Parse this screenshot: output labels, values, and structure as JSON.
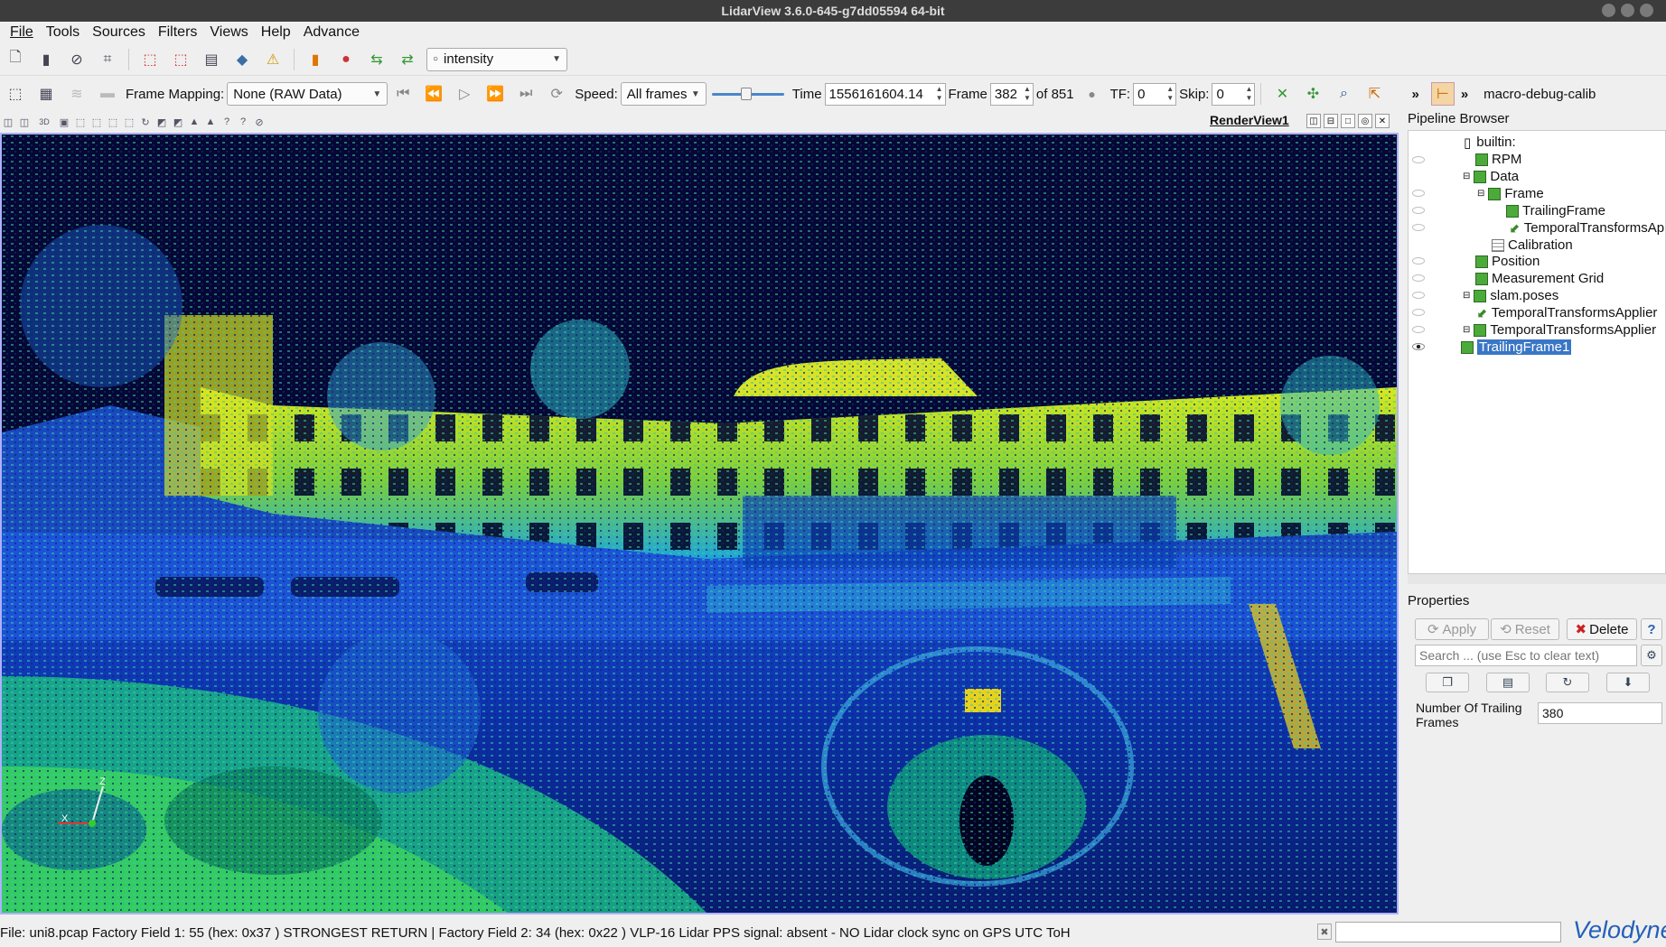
{
  "window": {
    "title": "LidarView 3.6.0-645-g7dd05594 64-bit"
  },
  "menu": [
    "File",
    "Tools",
    "Sources",
    "Filters",
    "Views",
    "Help",
    "Advance"
  ],
  "toolbar1": {
    "color_by": "intensity"
  },
  "toolbar2": {
    "frame_mapping_label": "Frame Mapping:",
    "frame_mapping_value": "None (RAW Data)",
    "speed_label": "Speed:",
    "speed_value": "All frames",
    "time_label": "Time",
    "time_value": "1556161604.14",
    "frame_label": "Frame",
    "frame_value": "382",
    "of_label": "of 851",
    "tf_label": "TF:",
    "tf_value": "0",
    "skip_label": "Skip:",
    "skip_value": "0",
    "overflow": "»",
    "overflow2": "»",
    "macro_label": "macro-debug-calib"
  },
  "render_view": {
    "title": "RenderView1",
    "axes": {
      "z": "Z",
      "x": "X"
    }
  },
  "pipeline_browser": {
    "title": "Pipeline Browser",
    "items": [
      {
        "label": "builtin:"
      },
      {
        "label": "RPM"
      },
      {
        "label": "Data"
      },
      {
        "label": "Frame"
      },
      {
        "label": "TrailingFrame"
      },
      {
        "label": "TemporalTransformsAp"
      },
      {
        "label": "Calibration"
      },
      {
        "label": "Position"
      },
      {
        "label": "Measurement Grid"
      },
      {
        "label": "slam.poses"
      },
      {
        "label": "TemporalTransformsApplier"
      },
      {
        "label": "TemporalTransformsApplier"
      },
      {
        "label": "TrailingFrame1"
      }
    ]
  },
  "properties": {
    "title": "Properties",
    "apply_label": "Apply",
    "reset_label": "Reset",
    "delete_label": "Delete",
    "help_label": "?",
    "search_placeholder": "Search ... (use Esc to clear text)",
    "trailing_label": "Number Of Trailing Frames",
    "trailing_value": "380"
  },
  "status_bar": {
    "text": "File: uni8.pcap     Factory Field 1: 55 (hex: 0x37 ) STRONGEST RETURN  |  Factory Field 2: 34 (hex: 0x22 ) VLP-16   Lidar PPS signal: absent - NO Lidar clock sync on GPS UTC ToH",
    "logo": "Velodyne"
  }
}
